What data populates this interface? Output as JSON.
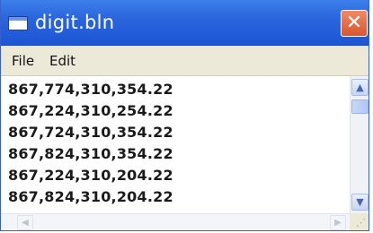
{
  "window": {
    "title": "digit.bln"
  },
  "titlebar": {
    "close_glyph": "✕",
    "app_icon": "notepad-icon"
  },
  "menu": {
    "items": [
      "File",
      "Edit"
    ]
  },
  "content": {
    "lines": [
      "867,774,310,354.22",
      "867,224,310,254.22",
      "867,724,310,354.22",
      "867,824,310,354.22",
      "867,224,310,204.22",
      "867,824,310,204.22"
    ]
  },
  "scrollbars": {
    "up_glyph": "▲",
    "down_glyph": "▼",
    "left_glyph": "◀",
    "right_glyph": "▶",
    "grip_glyph": "⋰"
  },
  "colors": {
    "titlebar": "#2a66de",
    "close_button": "#d8552e",
    "menubar": "#ece9d8"
  }
}
